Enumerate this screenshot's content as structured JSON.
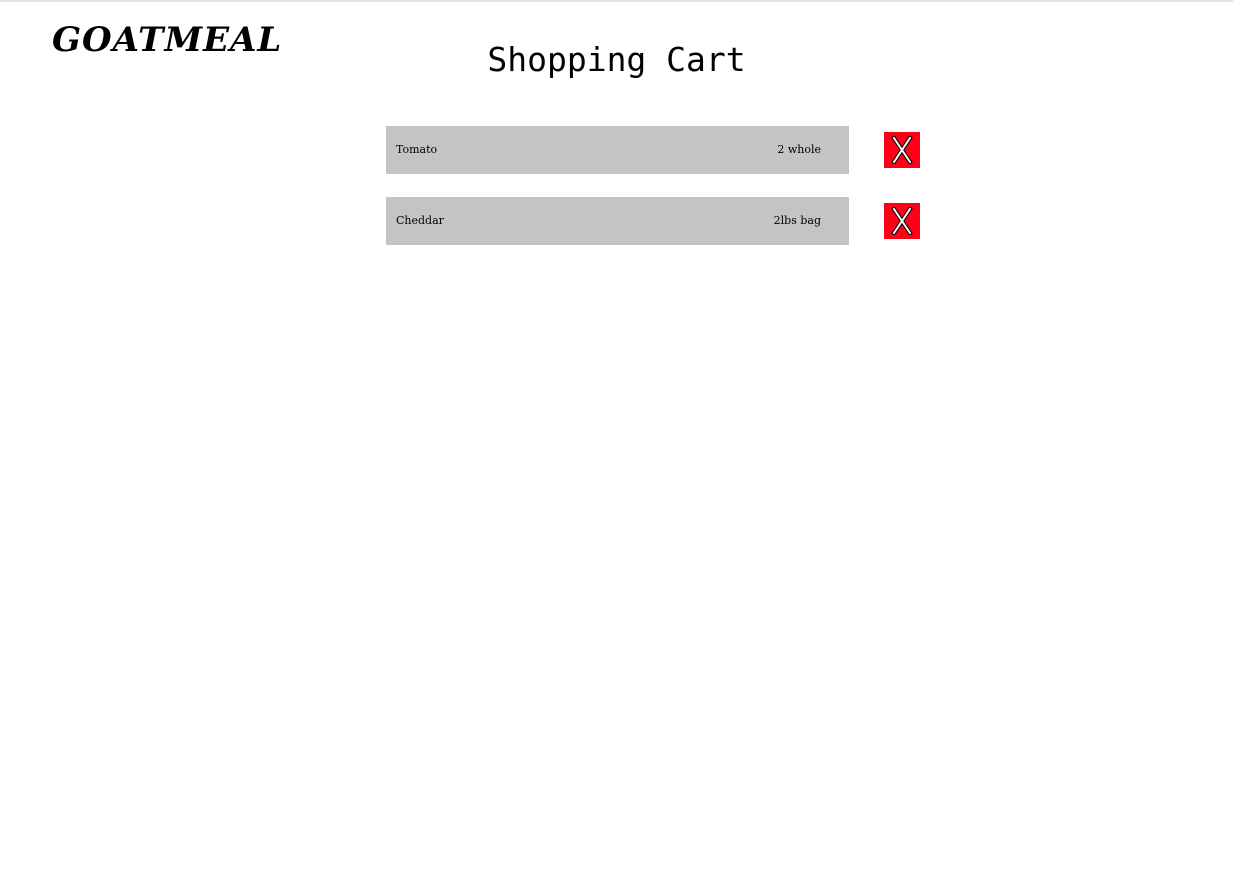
{
  "header": {
    "logo_text": "gOATMEAL",
    "title": "Shopping Cart"
  },
  "cart": {
    "items": [
      {
        "name": "Tomato",
        "quantity": "2 whole",
        "remove_label": "X"
      },
      {
        "name": "Cheddar",
        "quantity": "2lbs bag",
        "remove_label": "X"
      }
    ]
  },
  "colors": {
    "item_background": "#c4c4c4",
    "remove_button": "#ff0019"
  },
  "icons": {
    "remove": "close-icon"
  }
}
